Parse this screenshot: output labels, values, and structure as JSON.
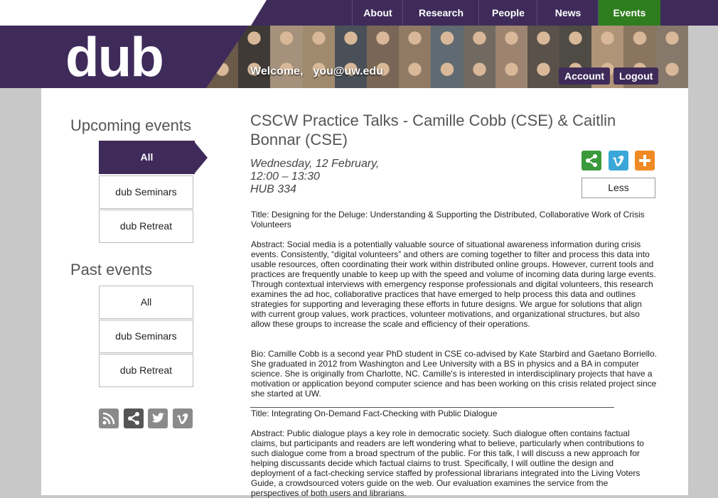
{
  "nav": {
    "items": [
      {
        "label": "About"
      },
      {
        "label": "Research"
      },
      {
        "label": "People"
      },
      {
        "label": "News"
      },
      {
        "label": "Events",
        "active": true
      }
    ]
  },
  "banner": {
    "logo": "dub",
    "welcome": "Welcome,",
    "email": "you@uw.edu",
    "account_label": "Account",
    "logout_label": "Logout"
  },
  "sidebar": {
    "upcoming_heading": "Upcoming events",
    "upcoming_items": [
      {
        "label": "All",
        "active": true
      },
      {
        "label": "dub Seminars"
      },
      {
        "label": "dub Retreat"
      }
    ],
    "past_heading": "Past events",
    "past_items": [
      {
        "label": "All"
      },
      {
        "label": "dub Seminars"
      },
      {
        "label": "dub Retreat"
      }
    ],
    "social_icons": [
      "rss-icon",
      "share-icon",
      "twitter-icon",
      "vimeo-icon"
    ]
  },
  "event": {
    "title": "CSCW Practice Talks - Camille Cobb (CSE) & Caitlin Bonnar (CSE)",
    "date": "Wednesday, 12 February,",
    "time": "12:00 – 13:30",
    "location": "HUB 334",
    "less_label": "Less",
    "share_icons": [
      "share-icon",
      "vimeo-icon",
      "plus-icon"
    ],
    "talk1_title": "Title: Designing for the Deluge: Understanding & Supporting the Distributed, Collaborative Work of Crisis Volunteers",
    "talk1_abstract": "Abstract:  Social media is a potentially valuable source of situational awareness information during crisis events. Consistently, “digital volunteers” and others are coming together to filter and process this data into usable resources, often coordinating their work within distributed online groups. However, current tools and practices are frequently unable to keep up with the speed and volume of incoming data during large events. Through contextual interviews with emergency response professionals and digital volunteers, this research examines the ad hoc, collaborative practices that have emerged to help process this data and outlines strategies for supporting and leveraging these efforts in future designs. We argue for solutions that align with current group values, work practices, volunteer motivations, and organizational structures, but also allow these groups to increase the scale and efficiency of their operations.",
    "talk1_bio": "Bio: Camille Cobb is a second year PhD student in CSE co-advised by Kate Starbird and Gaetano Borriello. She graduated in 2012 from Washington and Lee University with a BS in physics and a BA in computer science. She is originally from Charlotte, NC. Camille's is interested in interdisciplinary projects that have a motivation or application beyond computer science and has been working on this crisis related project since she started at UW.",
    "talk2_title": "Title: Integrating On-Demand Fact-Checking with Public Dialogue",
    "talk2_abstract": "Abstract: Public dialogue plays a key role in democratic society. Such dialogue often contains factual claims, but participants and readers are left wondering what to believe, particularly when contributions to such dialogue come from a broad spectrum of the public. For this talk, I will discuss a new approach for helping discussants decide which factual claims to trust. Specifically, I will outline the design and deployment of a fact-checking service staffed by professional librarians integrated into the Living Voters Guide, a crowdsourced voters guide on the web. Our evaluation examines the service from the perspectives of both users and librarians."
  },
  "colors": {
    "brand": "#3e2b5a",
    "active_nav": "#2e7d1e",
    "share_green": "#3b9a3b",
    "vimeo_blue": "#3aa7d8",
    "plus_orange": "#f08a24"
  }
}
